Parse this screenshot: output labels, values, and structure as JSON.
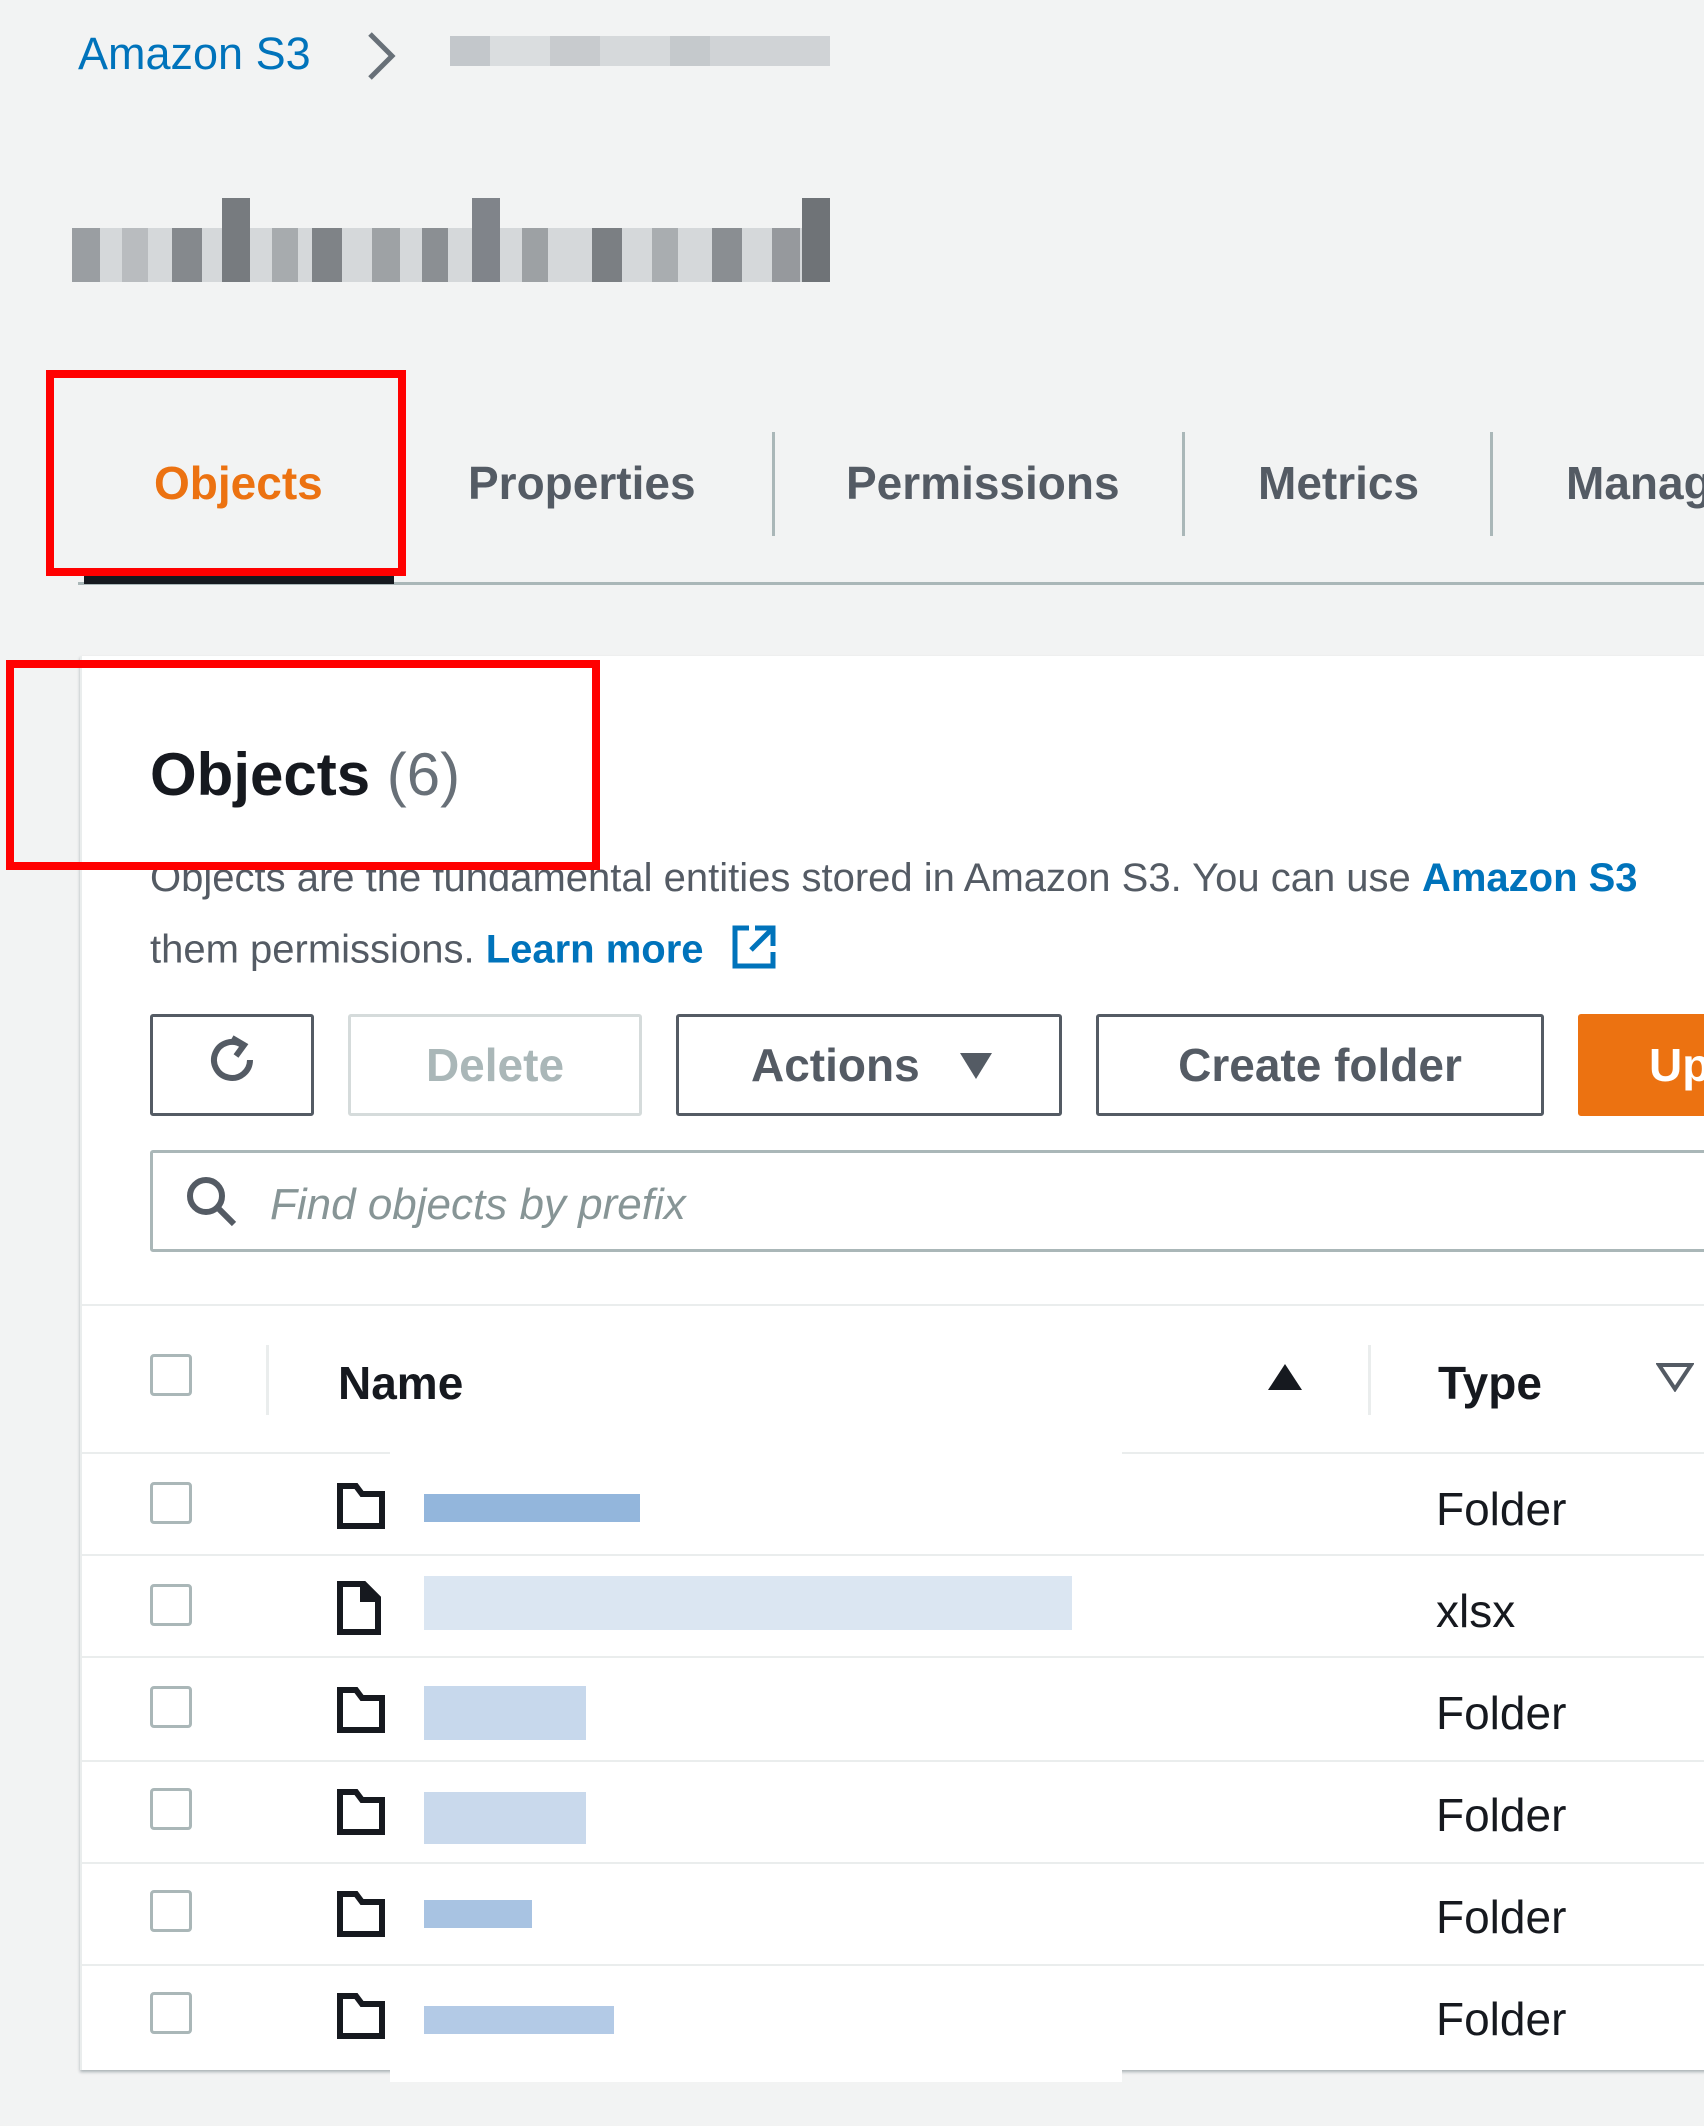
{
  "breadcrumb": {
    "root": "Amazon S3",
    "current_redacted": true
  },
  "bucket_name_redacted": true,
  "tabs": [
    {
      "label": "Objects",
      "active": true
    },
    {
      "label": "Properties",
      "active": false
    },
    {
      "label": "Permissions",
      "active": false
    },
    {
      "label": "Metrics",
      "active": false
    },
    {
      "label": "Manag",
      "active": false
    }
  ],
  "panel": {
    "title": "Objects",
    "count": "(6)",
    "description_line1": "Objects are the fundamental entities stored in Amazon S3. You can use",
    "description_link1": "Amazon S3",
    "description_line2": "them permissions.",
    "learn_more": "Learn more"
  },
  "toolbar": {
    "refresh_icon": "refresh-icon",
    "delete_label": "Delete",
    "actions_label": "Actions",
    "create_folder_label": "Create folder",
    "upload_label": "Up"
  },
  "search": {
    "placeholder": "Find objects by prefix"
  },
  "table": {
    "columns": [
      "Name",
      "Type"
    ],
    "rows": [
      {
        "icon": "folder-icon",
        "type": "Folder"
      },
      {
        "icon": "file-icon",
        "type": "xlsx"
      },
      {
        "icon": "folder-icon",
        "type": "Folder"
      },
      {
        "icon": "folder-icon",
        "type": "Folder"
      },
      {
        "icon": "folder-icon",
        "type": "Folder"
      },
      {
        "icon": "folder-icon",
        "type": "Folder"
      }
    ]
  },
  "colors": {
    "accent_orange": "#ec7211",
    "link_blue": "#0073bb",
    "annotation_red": "#ff0000"
  }
}
